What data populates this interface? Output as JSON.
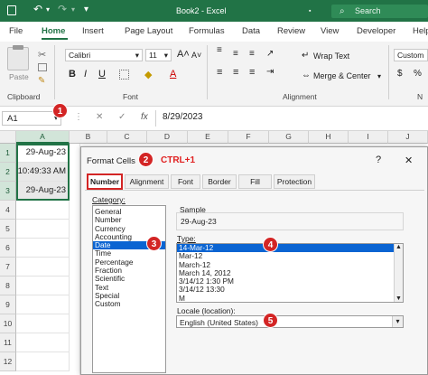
{
  "titlebar": {
    "doc_title": "Book2 - Excel",
    "search_placeholder": "Search",
    "autosave_indicator": "▪"
  },
  "ribbon_tabs": [
    "File",
    "Home",
    "Insert",
    "Page Layout",
    "Formulas",
    "Data",
    "Review",
    "View",
    "Developer",
    "Help"
  ],
  "ribbon": {
    "paste": "Paste",
    "clipboard": "Clipboard",
    "font_name": "Calibri",
    "font_size": "11",
    "font_group": "Font",
    "bold": "B",
    "italic": "I",
    "underline": "U",
    "wrap_text": "Wrap Text",
    "merge_center": "Merge & Center",
    "alignment_group": "Alignment",
    "number_format": "Custom",
    "number_short": "N"
  },
  "formula_bar": {
    "name_box": "A1",
    "fx": "fx",
    "value": "8/29/2023"
  },
  "columns": [
    "A",
    "B",
    "C",
    "D",
    "E",
    "F",
    "G",
    "H",
    "I",
    "J"
  ],
  "rows": [
    "1",
    "2",
    "3",
    "4",
    "5",
    "6",
    "7",
    "8",
    "9",
    "10",
    "11",
    "12"
  ],
  "cells": [
    "29-Aug-23",
    "10:49:33 AM",
    "29-Aug-23"
  ],
  "dialog": {
    "title": "Format Cells",
    "shortcut": "CTRL+1",
    "help": "?",
    "close": "✕",
    "tabs": [
      "Number",
      "Alignment",
      "Font",
      "Border",
      "Fill",
      "Protection"
    ],
    "category_label": "Category:",
    "categories": [
      "General",
      "Number",
      "Currency",
      "Accounting",
      "Date",
      "Time",
      "Percentage",
      "Fraction",
      "Scientific",
      "Text",
      "Special",
      "Custom"
    ],
    "selected_category": "Date",
    "sample_label": "Sample",
    "sample_value": "29-Aug-23",
    "type_label": "Type:",
    "types": [
      "14-Mar-12",
      "Mar-12",
      "March-12",
      "March 14, 2012",
      "3/14/12 1:30 PM",
      "3/14/12 13:30",
      "M"
    ],
    "selected_type": "14-Mar-12",
    "locale_label": "Locale (location):",
    "locale_value": "English (United States)"
  },
  "badges": [
    "1",
    "2",
    "3",
    "4",
    "5"
  ],
  "colors": {
    "excel_green": "#217346",
    "badge_red": "#d32525",
    "selection_blue": "#0a64d2",
    "shortcut_red": "#e02020"
  }
}
